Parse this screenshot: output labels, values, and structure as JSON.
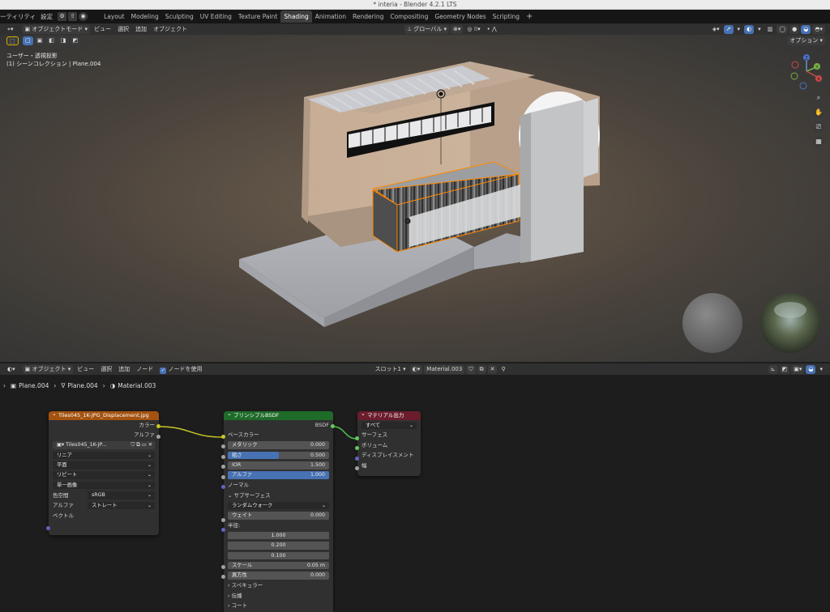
{
  "window_title": "* interia - Blender 4.2.1 LTS",
  "topbar": {
    "menus": [
      "ーティリティ",
      "設定"
    ],
    "workspaces": [
      {
        "label": "Layout",
        "active": false
      },
      {
        "label": "Modeling",
        "active": false
      },
      {
        "label": "Sculpting",
        "active": false
      },
      {
        "label": "UV Editing",
        "active": false
      },
      {
        "label": "Texture Paint",
        "active": false
      },
      {
        "label": "Shading",
        "active": true
      },
      {
        "label": "Animation",
        "active": false
      },
      {
        "label": "Rendering",
        "active": false
      },
      {
        "label": "Compositing",
        "active": false
      },
      {
        "label": "Geometry Nodes",
        "active": false
      },
      {
        "label": "Scripting",
        "active": false
      }
    ],
    "add_tab": "+"
  },
  "viewport_header": {
    "mode": "オブジェクトモード",
    "menus": [
      "ビュー",
      "選択",
      "追加",
      "オブジェクト"
    ],
    "transform_orientation": "グローバル",
    "options": "オプション"
  },
  "viewport": {
    "view_name": "ユーザー・透視投影",
    "collection_info": "(1) シーンコレクション | Plane.004",
    "gizmo_axes": [
      "Z",
      "Y",
      "X"
    ]
  },
  "node_header": {
    "mode": "オブジェクト",
    "menus": [
      "ビュー",
      "選択",
      "追加",
      "ノード"
    ],
    "use_nodes_label": "ノードを使用",
    "use_nodes": true,
    "slot": "スロット1",
    "material": "Material.003"
  },
  "breadcrumb": {
    "object": "Plane.004",
    "mesh": "Plane.004",
    "material": "Material.003"
  },
  "image_node": {
    "title": "Tiles045_1K-JPG_Displacement.jpg",
    "header_color": "#a3520f",
    "out_color": "カラー",
    "out_alpha": "アルファ",
    "image_name": "Tiles045_1K-JP...",
    "interpolation": "リニア",
    "projection": "平面",
    "extension": "リピート",
    "source": "単一画像",
    "colorspace_label": "色空間",
    "colorspace": "sRGB",
    "alpha_label": "アルファ",
    "alpha_mode": "ストレート",
    "in_vector": "ベクトル"
  },
  "bsdf_node": {
    "title": "プリンシプルBSDF",
    "header_color": "#1f6b2a",
    "out_bsdf": "BSDF",
    "base_color": "ベースカラー",
    "metallic_label": "メタリック",
    "metallic": "0.000",
    "metallic_fill": 0,
    "roughness_label": "粗さ",
    "roughness": "0.500",
    "roughness_fill": 0.5,
    "ior_label": "IOR",
    "ior": "1.500",
    "ior_fill": 0,
    "alpha_label": "アルファ",
    "alpha": "1.000",
    "alpha_fill": 1,
    "normal": "ノーマル",
    "subsurface": "サブサーフェス",
    "subsurface_method": "ランダムウォーク",
    "weight_label": "ウェイト",
    "weight": "0.000",
    "radius_label": "半径:",
    "radius": [
      "1.000",
      "0.200",
      "0.100"
    ],
    "scale_label": "スケール",
    "scale": "0.05 m",
    "anisotropy_label": "異方性",
    "anisotropy": "0.000",
    "specular": "スペキュラー",
    "transmission": "伝播",
    "coat": "コート"
  },
  "output_node": {
    "title": "マテリアル出力",
    "header_color": "#6b1d2d",
    "target": "すべて",
    "surface": "サーフェス",
    "volume": "ボリューム",
    "displacement": "ディスプレイスメント",
    "thickness": "幅"
  }
}
